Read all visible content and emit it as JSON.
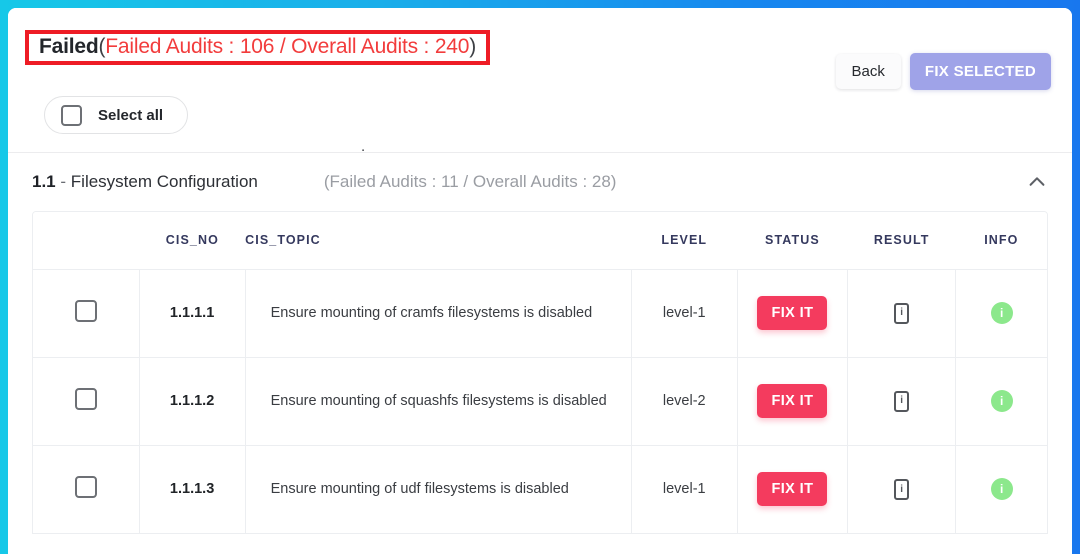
{
  "window": {
    "accent_gradient_start": "#16c8e8",
    "accent_gradient_end": "#1877ee"
  },
  "header": {
    "status_label": "Failed",
    "counts_open": "(",
    "counts_text": "Failed Audits : 106 / Overall Audits : 240",
    "counts_close": ")",
    "failed_audits": 106,
    "overall_audits": 240,
    "highlight_color": "#ee1c25",
    "counts_color": "#f23c3c",
    "back_label": "Back",
    "fix_selected_label": "FIX SELECTED",
    "fix_selected_color": "#9fa3e8",
    "select_all_label": "Select all",
    "stray_char": "."
  },
  "section": {
    "number": "1.1",
    "separator": "-",
    "name": "Filesystem Configuration",
    "counts": "(Failed Audits : 11 / Overall Audits : 28)",
    "failed_audits": 11,
    "overall_audits": 28,
    "collapse_icon": "chevron-up-icon"
  },
  "table": {
    "columns": [
      "",
      "CIS_NO",
      "CIS_TOPIC",
      "LEVEL",
      "STATUS",
      "RESULT",
      "INFO"
    ],
    "rows": [
      {
        "cis_no": "1.1.1.1",
        "cis_topic": "Ensure mounting of cramfs filesystems is disabled",
        "level": "level-1",
        "status": "FIX IT",
        "result": "result-info-icon",
        "info": "info-icon"
      },
      {
        "cis_no": "1.1.1.2",
        "cis_topic": "Ensure mounting of squashfs filesystems is disabled",
        "level": "level-2",
        "status": "FIX IT",
        "result": "result-info-icon",
        "info": "info-icon"
      },
      {
        "cis_no": "1.1.1.3",
        "cis_topic": "Ensure mounting of udf filesystems is disabled",
        "level": "level-1",
        "status": "FIX IT",
        "result": "result-info-icon",
        "info": "info-icon"
      }
    ],
    "status_button_color": "#f43b5e",
    "info_icon_color": "#8ce88c",
    "info_glyph": "i"
  }
}
